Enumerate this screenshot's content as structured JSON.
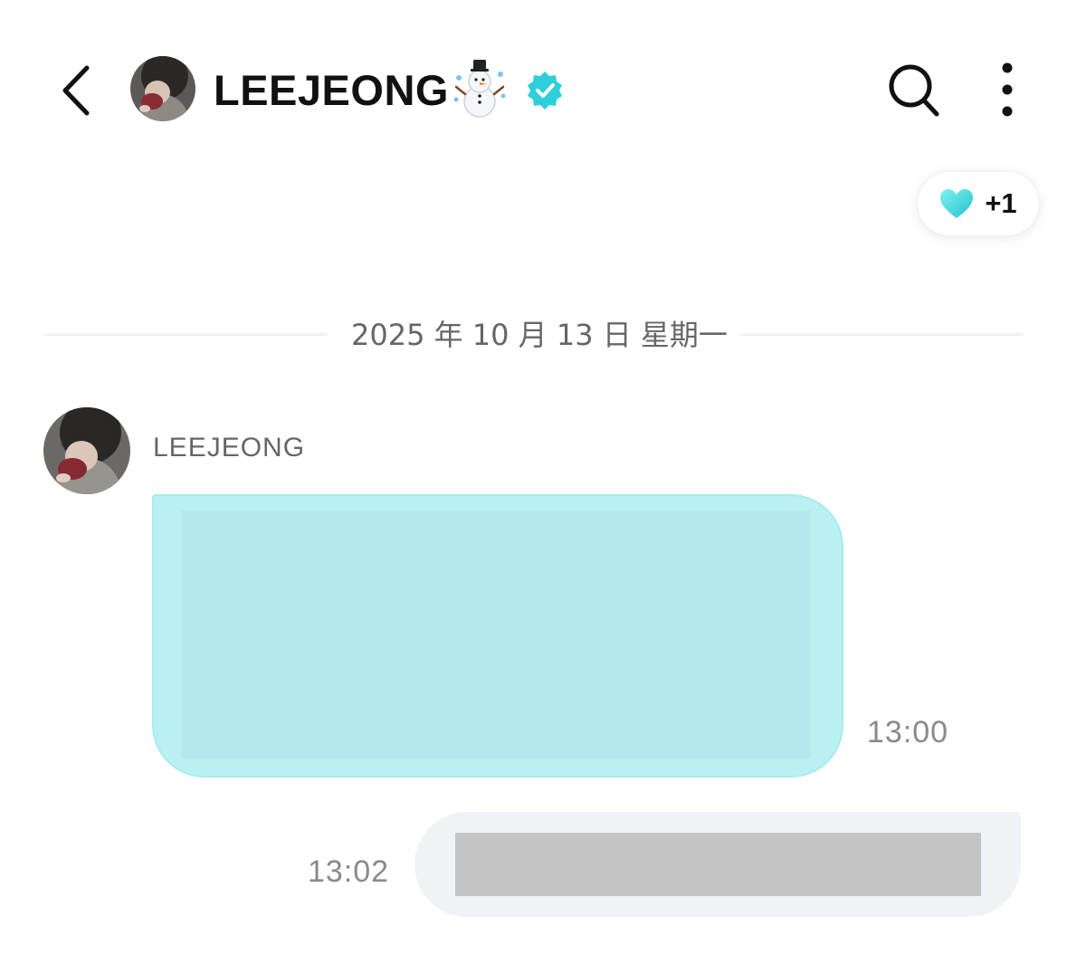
{
  "header": {
    "back_icon": "chevron-left-icon",
    "name": "LEEJEONG",
    "emoji": "snowman-icon",
    "verified_icon": "verified-badge-icon",
    "search_icon": "search-icon",
    "more_icon": "more-vertical-icon"
  },
  "reaction": {
    "icon": "heart-icon",
    "count": "+1"
  },
  "date_divider": {
    "text": "2025 年 10 月 13 日 星期一"
  },
  "messages": [
    {
      "direction": "incoming",
      "sender": "LEEJEONG",
      "time": "13:00"
    },
    {
      "direction": "outgoing",
      "time": "13:02"
    }
  ],
  "colors": {
    "accent": "#2ecfda",
    "incoming_bubble": "#b9f0f1",
    "outgoing_bubble": "#f1f2f6",
    "redacted": "#c4c4c4",
    "muted_text": "#8a8a8a"
  }
}
